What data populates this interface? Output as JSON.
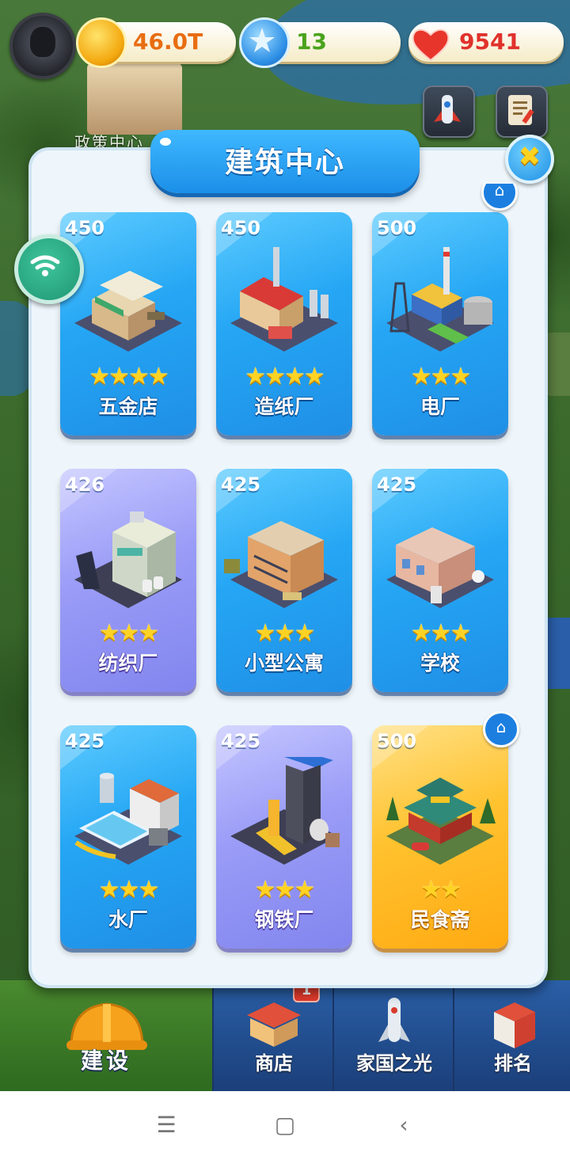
{
  "colors": {
    "card_blue": "#25a6f4",
    "card_purple": "#9a9cf7",
    "card_gold": "#ffc22f",
    "coin_text": "#e86d12",
    "star_text": "#4aa31c",
    "heart_text": "#e0322b"
  },
  "background": {
    "location_label": "政策中心"
  },
  "topbar": {
    "avatar_icon": "player-avatar",
    "coins": "46.0T",
    "stars": "13",
    "hearts": "9541",
    "coin_icon": "gold-coin-icon",
    "star_icon": "blue-star-icon",
    "heart_icon": "heart-icon"
  },
  "dialog": {
    "title": "建筑中心",
    "close_icon": "close-x-icon",
    "buildings": [
      {
        "cost": "450",
        "stars": "★★★★",
        "name": "五金店",
        "tier": "blue"
      },
      {
        "cost": "450",
        "stars": "★★★★",
        "name": "造纸厂",
        "tier": "blue"
      },
      {
        "cost": "500",
        "stars": "★★★",
        "name": "电厂",
        "tier": "blue"
      },
      {
        "cost": "426",
        "stars": "★★★",
        "name": "纺织厂",
        "tier": "purple"
      },
      {
        "cost": "425",
        "stars": "★★★",
        "name": "小型公寓",
        "tier": "blue"
      },
      {
        "cost": "425",
        "stars": "★★★",
        "name": "学校",
        "tier": "blue"
      },
      {
        "cost": "425",
        "stars": "★★★",
        "name": "水厂",
        "tier": "blue"
      },
      {
        "cost": "425",
        "stars": "★★★",
        "name": "钢铁厂",
        "tier": "purple"
      },
      {
        "cost": "500",
        "stars": "★★",
        "name": "民食斋",
        "tier": "gold"
      }
    ],
    "home_badge_icon": "⌂"
  },
  "nav": {
    "build": "建设",
    "shop": "商店",
    "shop_badge": "1",
    "glory": "家国之光",
    "rank": "排名"
  },
  "system": {
    "menu": "☰",
    "home": "▢",
    "back": "‹"
  }
}
